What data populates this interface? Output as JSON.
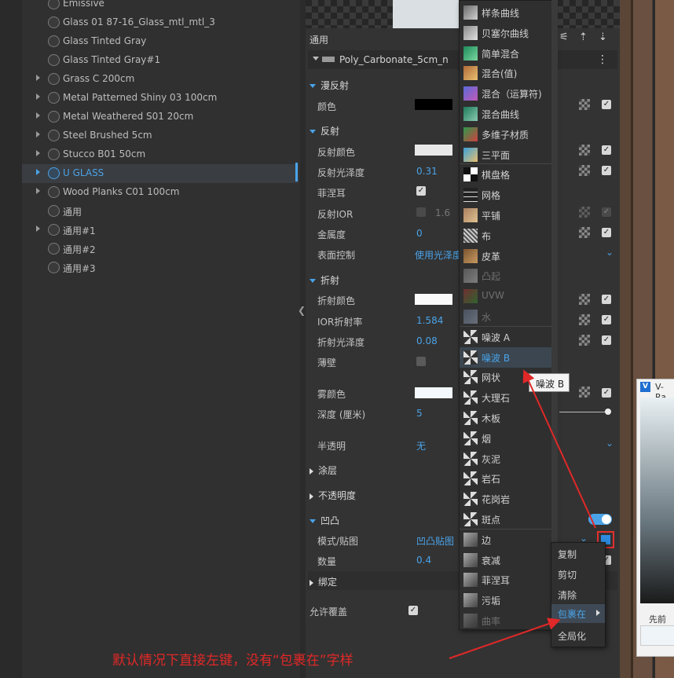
{
  "materials": [
    {
      "name": "Emissive",
      "expandable": false
    },
    {
      "name": "Glass 01 87-16_Glass_mtl_mtl_3",
      "expandable": false
    },
    {
      "name": "Glass Tinted Gray",
      "expandable": false
    },
    {
      "name": "Glass Tinted Gray#1",
      "expandable": false
    },
    {
      "name": "Grass C 200cm",
      "expandable": true
    },
    {
      "name": "Metal Patterned Shiny 03 100cm",
      "expandable": true
    },
    {
      "name": "Metal Weathered S01 20cm",
      "expandable": true
    },
    {
      "name": "Steel Brushed 5cm",
      "expandable": true
    },
    {
      "name": "Stucco B01 50cm",
      "expandable": true
    },
    {
      "name": "U GLASS",
      "expandable": true,
      "selected": true
    },
    {
      "name": "Wood Planks C01 100cm",
      "expandable": true
    },
    {
      "name": "通用",
      "expandable": false
    },
    {
      "name": "通用#1",
      "expandable": true
    },
    {
      "name": "通用#2",
      "expandable": false
    },
    {
      "name": "通用#3",
      "expandable": false
    }
  ],
  "panel": {
    "title": "通用",
    "material_name": "Poly_Carbonate_5cm_n",
    "sections": {
      "diffuse": "漫反射",
      "reflection": "反射",
      "refraction": "折射",
      "coat": "涂层",
      "opacity": "不透明度",
      "bump": "凹凸",
      "binding": "绑定"
    },
    "props": {
      "color": "颜色",
      "refl_color": "反射颜色",
      "refl_gloss": "反射光泽度",
      "refl_gloss_val": "0.31",
      "fresnel": "菲涅耳",
      "refl_ior": "反射IOR",
      "refl_ior_val": "1.6",
      "metalness": "金属度",
      "metalness_val": "0",
      "surface_ctrl": "表面控制",
      "surface_ctrl_val": "使用光泽度",
      "refr_color": "折射颜色",
      "ior": "IOR折射率",
      "ior_val": "1.584",
      "refr_gloss": "折射光泽度",
      "refr_gloss_val": "0.08",
      "thin_wall": "薄壁",
      "fog_color": "雾颜色",
      "depth": "深度 (厘米)",
      "depth_val": "5",
      "translucency": "半透明",
      "translucency_val": "无",
      "mode_map": "模式/贴图",
      "mode_map_val": "凹凸贴图",
      "amount": "数量",
      "amount_val": "0.4",
      "allow_override": "允许覆盖"
    }
  },
  "texture_menu": [
    {
      "label": "样条曲线",
      "icon": "spline-curve-icon"
    },
    {
      "label": "贝塞尔曲线",
      "icon": "bezier-curve-icon"
    },
    {
      "label": "简单混合",
      "icon": "simple-mix-icon"
    },
    {
      "label": "混合(值)",
      "icon": "mix-value-icon"
    },
    {
      "label": "混合（运算符)",
      "icon": "mix-operator-icon"
    },
    {
      "label": "混合曲线",
      "icon": "mix-curve-icon"
    },
    {
      "label": "多维子材质",
      "icon": "multi-sub-icon"
    },
    {
      "label": "三平面",
      "icon": "triplanar-icon"
    },
    {
      "label": "棋盘格",
      "icon": "checker-icon"
    },
    {
      "label": "网格",
      "icon": "grid-icon"
    },
    {
      "label": "平铺",
      "icon": "tiles-icon"
    },
    {
      "label": "布",
      "icon": "cloth-icon"
    },
    {
      "label": "皮革",
      "icon": "leather-icon"
    },
    {
      "label": "凸起",
      "icon": "bump-icon",
      "disabled": true
    },
    {
      "label": "UVW",
      "icon": "uvw-icon",
      "disabled": true
    },
    {
      "label": "水",
      "icon": "water-icon",
      "disabled": true
    },
    {
      "label": "噪波 A",
      "icon": "noise-a-icon"
    },
    {
      "label": "噪波 B",
      "icon": "noise-b-icon",
      "highlighted": true
    },
    {
      "label": "网状",
      "icon": "cellular-icon"
    },
    {
      "label": "大理石",
      "icon": "marble-icon"
    },
    {
      "label": "木板",
      "icon": "wood-icon"
    },
    {
      "label": "烟",
      "icon": "smoke-icon"
    },
    {
      "label": "灰泥",
      "icon": "stucco-icon"
    },
    {
      "label": "岩石",
      "icon": "rock-icon"
    },
    {
      "label": "花岗岩",
      "icon": "granite-icon"
    },
    {
      "label": "斑点",
      "icon": "speckle-icon"
    },
    {
      "label": "边",
      "icon": "edges-icon"
    },
    {
      "label": "衰减",
      "icon": "falloff-icon"
    },
    {
      "label": "菲涅耳",
      "icon": "fresnel-icon"
    },
    {
      "label": "污垢",
      "icon": "dirt-icon"
    },
    {
      "label": "曲率",
      "icon": "curvature-icon",
      "disabled": true
    }
  ],
  "tooltip": "噪波 B",
  "context_menu": [
    "复制",
    "剪切",
    "清除",
    "包裹在",
    "全局化"
  ],
  "vray": {
    "title": "V-Ra",
    "prev_label": "先前"
  },
  "annotation": "默认情况下直接左键，没有“包裹在”字样",
  "colors": {
    "accent": "#4aa3e8",
    "annotation": "#e02828"
  }
}
